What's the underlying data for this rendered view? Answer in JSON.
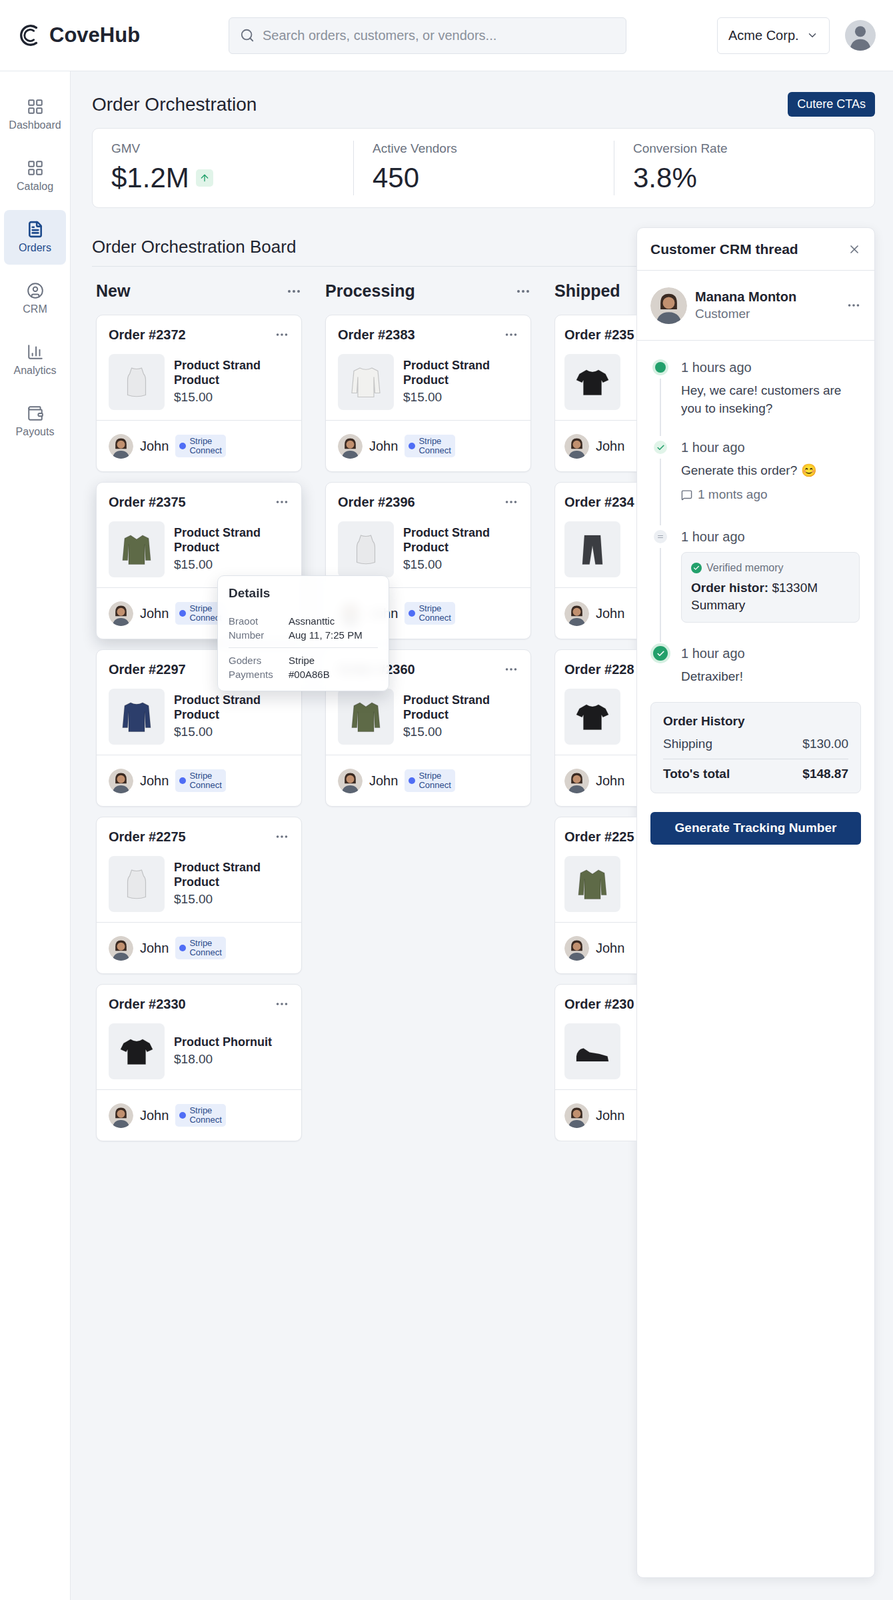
{
  "app": {
    "logo": "CoveHub",
    "search": {
      "placeholder": "Search orders, customers, or vendors..."
    },
    "org": "Acme Corp."
  },
  "sidebar": {
    "items": [
      {
        "label": "Dashboard",
        "selected": false
      },
      {
        "label": "Catalog",
        "selected": false
      },
      {
        "label": "Orders",
        "selected": true
      },
      {
        "label": "CRM",
        "selected": false
      },
      {
        "label": "Analytics",
        "selected": false
      },
      {
        "label": "Payouts",
        "selected": false
      }
    ]
  },
  "page": {
    "title": "Order Orchestration",
    "action": "Cutere CTAs"
  },
  "stats": [
    {
      "label": "GMV",
      "value": "$1.2M",
      "trend": "up"
    },
    {
      "label": "Active Vendors",
      "value": "450"
    },
    {
      "label": "Conversion Rate",
      "value": "3.8%"
    }
  ],
  "board": {
    "title": "Order Orchestration Board",
    "columns": [
      {
        "title": "New",
        "covered": false,
        "cards": [
          {
            "number": "Order #2372",
            "product": {
              "kind": "vest",
              "color": "#e8e9eb"
            },
            "name": "Product Strand Product",
            "price": "$15.00",
            "customer": "John",
            "badge": [
              "Stripe",
              "Connect"
            ],
            "selected": false
          },
          {
            "number": "Order #2375",
            "product": {
              "kind": "jacket",
              "color": "#5e6a47"
            },
            "name": "Product Strand Product",
            "price": "$15.00",
            "customer": "John",
            "badge": [
              "Stripe",
              "Connect"
            ],
            "selected": true,
            "details": {
              "title": "Details",
              "rows": [
                {
                  "label": [
                    "Braoot",
                    "Number"
                  ],
                  "value": [
                    "Assnanttic",
                    "Aug 11, 7:25 PM"
                  ]
                },
                {
                  "label": [
                    "Goders",
                    "Payments"
                  ],
                  "value": [
                    "Stripe",
                    "#00A86B"
                  ]
                }
              ]
            }
          },
          {
            "number": "Order #2297",
            "product": {
              "kind": "sweater",
              "color": "#2c3e6b"
            },
            "name": "Product Strand Product",
            "price": "$15.00",
            "customer": "John",
            "badge": [
              "Stripe",
              "Connect"
            ],
            "selected": false
          },
          {
            "number": "Order #2275",
            "product": {
              "kind": "vest",
              "color": "#e8e9eb"
            },
            "name": "Product Strand Product",
            "price": "$15.00",
            "customer": "John",
            "badge": [
              "Stripe",
              "Connect"
            ],
            "selected": false
          },
          {
            "number": "Order #2330",
            "product": {
              "kind": "tee",
              "color": "#1b1b1d"
            },
            "name": "Product Phornuit",
            "price": "$18.00",
            "customer": "John",
            "badge": [
              "Stripe",
              "Connect"
            ],
            "selected": false
          }
        ]
      },
      {
        "title": "Processing",
        "covered": false,
        "cards": [
          {
            "number": "Order #2383",
            "product": {
              "kind": "sweater",
              "color": "#f1f1ef"
            },
            "name": "Product Strand Product",
            "price": "$15.00",
            "customer": "John",
            "badge": [
              "Stripe",
              "Connect"
            ],
            "selected": false
          },
          {
            "number": "Order #2396",
            "product": {
              "kind": "vest",
              "color": "#e8e9eb"
            },
            "name": "Product Strand Product",
            "price": "$15.00",
            "customer": "John",
            "badge": [
              "Stripe",
              "Connect"
            ],
            "selected": false
          },
          {
            "number": "Order #2360",
            "product": {
              "kind": "jacket",
              "color": "#5e6a47"
            },
            "name": "Product Strand Product",
            "price": "$15.00",
            "customer": "John",
            "badge": [
              "Stripe",
              "Connect"
            ],
            "selected": false
          }
        ]
      },
      {
        "title": "Shipped",
        "covered": true,
        "cards": [
          {
            "number": "Order #235",
            "product": {
              "kind": "tee",
              "color": "#1b1b1d"
            },
            "customer": "John",
            "selected": false
          },
          {
            "number": "Order #234",
            "product": {
              "kind": "pants",
              "color": "#3b3d42"
            },
            "customer": "John",
            "selected": false
          },
          {
            "number": "Order #228",
            "product": {
              "kind": "tee",
              "color": "#1b1b1d"
            },
            "customer": "John",
            "selected": false
          },
          {
            "number": "Order #225",
            "product": {
              "kind": "jacket",
              "color": "#5e6a47"
            },
            "customer": "John",
            "selected": false
          },
          {
            "number": "Order #230",
            "product": {
              "kind": "sneaker",
              "color": "#1e1e21"
            },
            "customer": "John",
            "selected": false
          }
        ]
      }
    ]
  },
  "crm": {
    "title": "Customer CRM thread",
    "customer": {
      "name": "Manana Monton",
      "role": "Customer"
    },
    "timeline": [
      {
        "kind": "dot",
        "time": "1 hours ago",
        "message": "Hey, we care! customers are you to inseking?"
      },
      {
        "kind": "check",
        "time": "1 hour ago",
        "message": "Generate this order? 😊",
        "sub": "1 monts ago"
      },
      {
        "kind": "pending",
        "time": "1 hour ago",
        "memory": {
          "badge": "Verified memory",
          "label": "Order histor:",
          "value": "$1330M",
          "note": "Summary"
        }
      },
      {
        "kind": "check-circle",
        "time": "1 hour ago",
        "message": "Detraxiber!"
      }
    ],
    "history": {
      "title": "Order History",
      "rows": [
        {
          "label": "Shipping",
          "value": "$130.00",
          "bold": false
        },
        {
          "label": "Toto's total",
          "value": "$148.87",
          "bold": true
        }
      ]
    },
    "button": "Generate Tracking Number"
  }
}
